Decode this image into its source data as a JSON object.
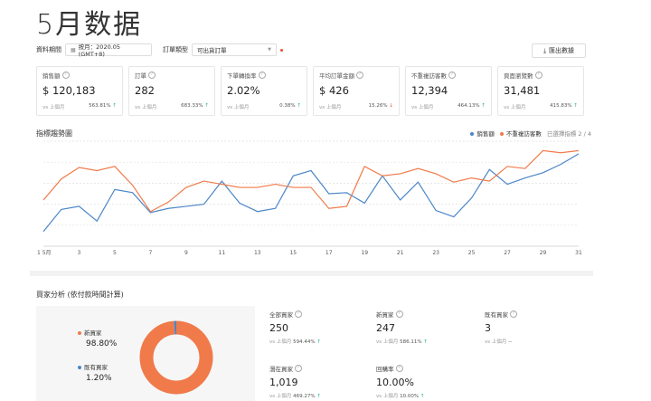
{
  "page_title": "5月数据",
  "filters": {
    "period_label": "資料期間",
    "period_value": "按月：2020.05 (GMT+8)",
    "order_type_label": "訂單類型",
    "order_type_value": "可出貨訂單",
    "export_label": "匯出數據"
  },
  "metrics": [
    {
      "label": "銷售額",
      "value": "$ 120,183",
      "compare": "vs 上個月",
      "change": "563.81%",
      "direction": "up"
    },
    {
      "label": "訂單",
      "value": "282",
      "compare": "vs 上個月",
      "change": "683.33%",
      "direction": "up"
    },
    {
      "label": "下單轉換率",
      "value": "2.02%",
      "compare": "vs 上個月",
      "change": "0.38%",
      "direction": "up"
    },
    {
      "label": "平均訂單金額",
      "value": "$ 426",
      "compare": "vs 上個月",
      "change": "15.26%",
      "direction": "down"
    },
    {
      "label": "不重複訪客數",
      "value": "12,394",
      "compare": "vs 上個月",
      "change": "464.13%",
      "direction": "up"
    },
    {
      "label": "頁面瀏覽數",
      "value": "31,481",
      "compare": "vs 上個月",
      "change": "415.83%",
      "direction": "up"
    }
  ],
  "trend": {
    "title": "指標趨勢圖",
    "selected_note": "已選擇指標 2 / 4"
  },
  "chart_data": {
    "type": "line",
    "x": [
      1,
      2,
      3,
      4,
      5,
      6,
      7,
      8,
      9,
      10,
      11,
      12,
      13,
      14,
      15,
      16,
      17,
      18,
      19,
      20,
      21,
      22,
      23,
      24,
      25,
      26,
      27,
      28,
      29,
      30,
      31
    ],
    "x_ticks": [
      "1 5月",
      "3",
      "5",
      "7",
      "9",
      "11",
      "13",
      "15",
      "17",
      "19",
      "21",
      "23",
      "25",
      "27",
      "29",
      "31"
    ],
    "x_tick_values": [
      1,
      3,
      5,
      7,
      9,
      11,
      13,
      15,
      17,
      19,
      21,
      23,
      25,
      27,
      29,
      31
    ],
    "ylim": [
      0,
      100
    ],
    "grid": true,
    "legend_position": "top-right",
    "series": [
      {
        "name": "銷售額",
        "color": "#4a86c8",
        "values": [
          14,
          35,
          38,
          24,
          54,
          51,
          32,
          36,
          38,
          40,
          62,
          41,
          33,
          36,
          67,
          72,
          50,
          51,
          41,
          67,
          44,
          61,
          34,
          28,
          46,
          73,
          59,
          65,
          70,
          78,
          88
        ]
      },
      {
        "name": "不重複訪客數",
        "color": "#f07a4a",
        "values": [
          44,
          64,
          75,
          72,
          76,
          58,
          33,
          42,
          56,
          62,
          59,
          56,
          56,
          59,
          56,
          56,
          36,
          38,
          76,
          67,
          69,
          74,
          69,
          61,
          65,
          62,
          76,
          74,
          91,
          89,
          91
        ]
      }
    ]
  },
  "buyer": {
    "title": "買家分析 (依付款時間計算)",
    "donut": {
      "new_label": "新買家",
      "new_pct": "98.80%",
      "new_value": 98.8,
      "new_color": "#f07a4a",
      "old_label": "既有買家",
      "old_pct": "1.20%",
      "old_value": 1.2,
      "old_color": "#4a86c8"
    },
    "stats": [
      {
        "label": "全部買家",
        "value": "250",
        "compare": "vs 上個月",
        "change": "594.44%",
        "direction": "up"
      },
      {
        "label": "新買家",
        "value": "247",
        "compare": "vs 上個月",
        "change": "586.11%",
        "direction": "up"
      },
      {
        "label": "既有買家",
        "value": "3",
        "compare": "vs 上個月",
        "change": "--",
        "direction": "none"
      },
      {
        "label": "潛在買家",
        "value": "1,019",
        "compare": "vs 上個月",
        "change": "469.27%",
        "direction": "up"
      },
      {
        "label": "回購率",
        "value": "10.00%",
        "compare": "vs 上個月",
        "change": "10.00%",
        "direction": "up"
      }
    ]
  }
}
